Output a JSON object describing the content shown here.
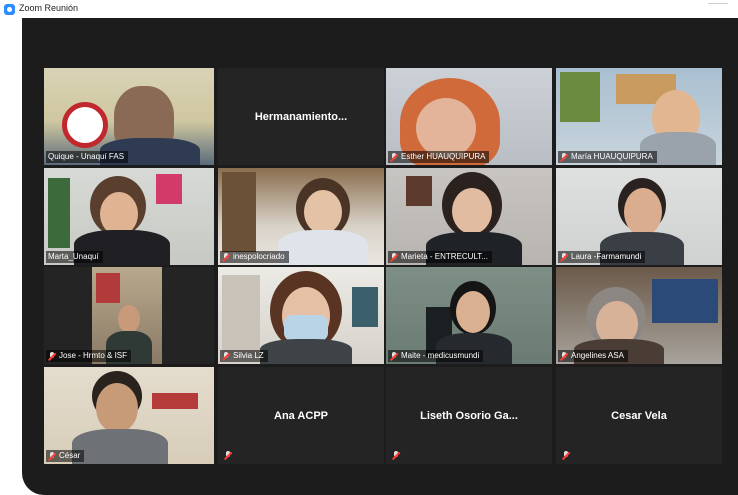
{
  "window": {
    "title": "Zoom Reunión"
  },
  "colors": {
    "background": "#1c1c1c",
    "tile": "#242424",
    "active_speaker": "#bfe043",
    "muted": "#ff3b30"
  },
  "participants": [
    {
      "name": "Quique - Unaquí FAS",
      "video": true,
      "muted": false,
      "active": true
    },
    {
      "name": "Hermanamiento...",
      "video": false,
      "muted": false
    },
    {
      "name": "Esther HUAUQUIPURA",
      "video": true,
      "muted": true
    },
    {
      "name": "María HUAUQUIPURA",
      "video": true,
      "muted": true
    },
    {
      "name": "Marta_Unaquí",
      "video": true,
      "muted": false
    },
    {
      "name": "inespolocriado",
      "video": true,
      "muted": true
    },
    {
      "name": "Marieta - ENTRECULT...",
      "video": true,
      "muted": true
    },
    {
      "name": "Laura -Farmamundi",
      "video": true,
      "muted": true
    },
    {
      "name": "Jose - Hrmto & ISF",
      "video": true,
      "muted": true
    },
    {
      "name": "Silvia LZ",
      "video": true,
      "muted": true
    },
    {
      "name": "Maite - medicusmundi",
      "video": true,
      "muted": true
    },
    {
      "name": "Angelines ASA",
      "video": true,
      "muted": true
    },
    {
      "name": "César",
      "video": true,
      "muted": true
    },
    {
      "name": "Ana ACPP",
      "video": false,
      "muted": true
    },
    {
      "name": "Liseth Osorio Ga...",
      "video": false,
      "muted": true
    },
    {
      "name": "Cesar Vela",
      "video": false,
      "muted": true
    }
  ]
}
